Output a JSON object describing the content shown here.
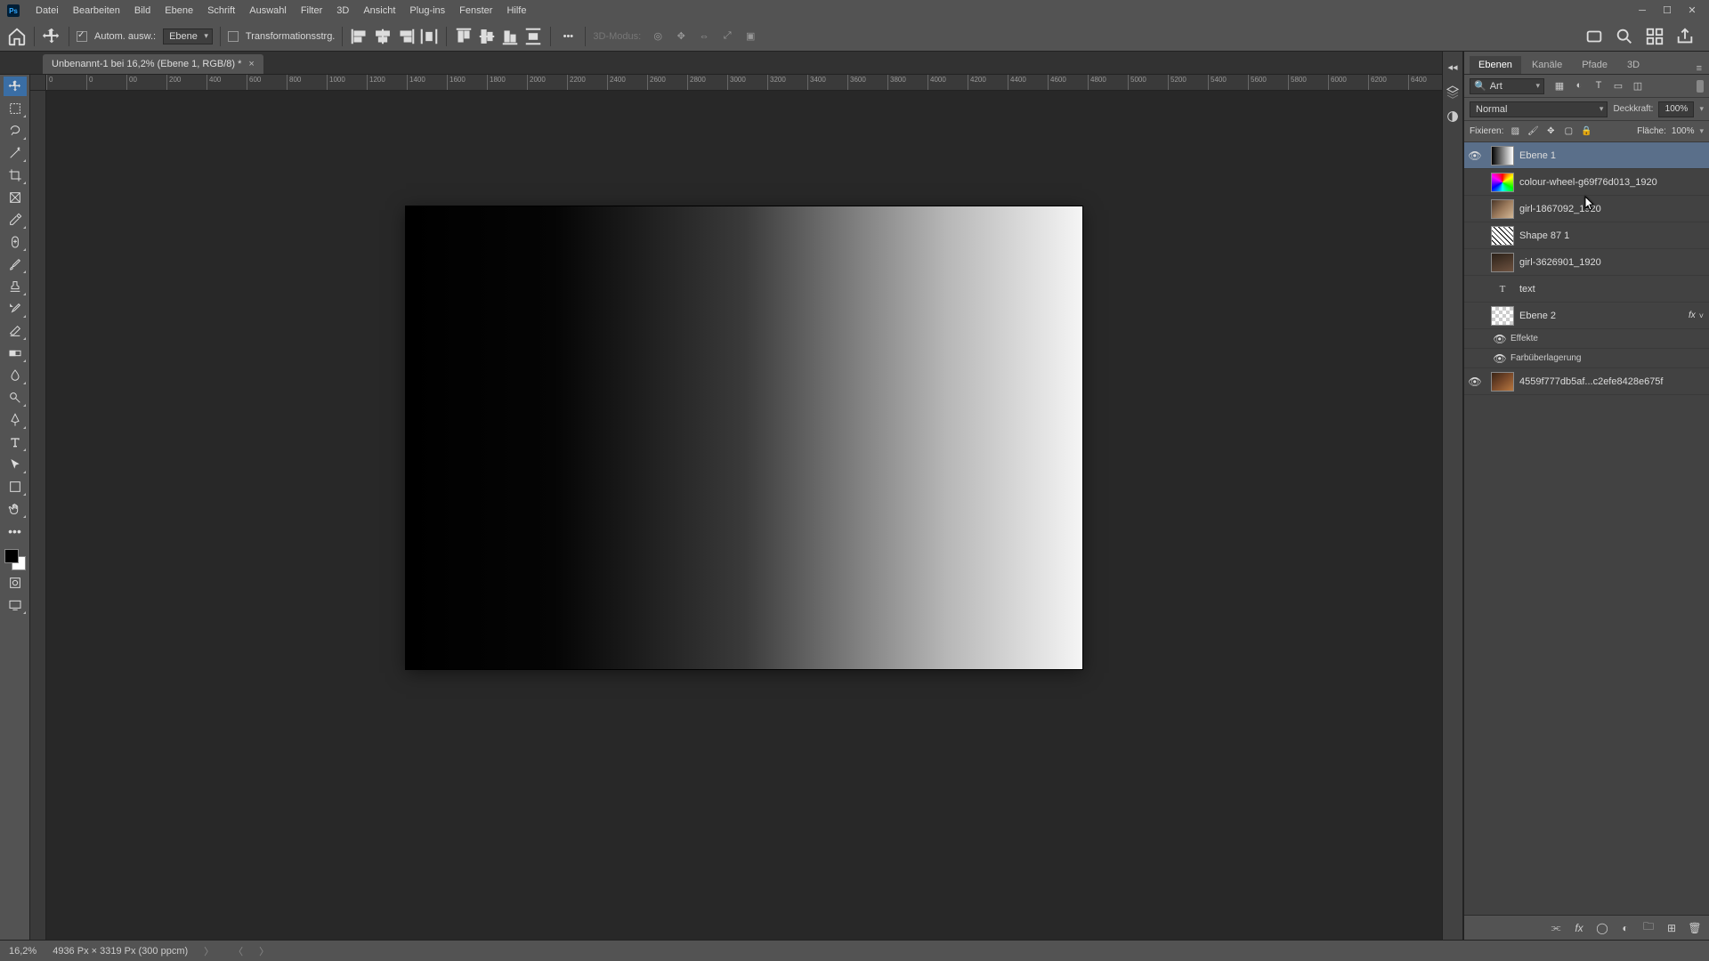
{
  "menubar": {
    "items": [
      "Datei",
      "Bearbeiten",
      "Bild",
      "Ebene",
      "Schrift",
      "Auswahl",
      "Filter",
      "3D",
      "Ansicht",
      "Plug-ins",
      "Fenster",
      "Hilfe"
    ]
  },
  "optbar": {
    "auto_select_label": "Autom. ausw.:",
    "auto_select_mode": "Ebene",
    "transform_label": "Transformationsstrg.",
    "threed_mode": "3D-Modus:"
  },
  "doc_tab": {
    "title": "Unbenannt-1 bei 16,2% (Ebene 1, RGB/8) *"
  },
  "ruler_ticks": [
    "0",
    "0",
    "00",
    "200",
    "400",
    "600",
    "800",
    "1000",
    "1200",
    "1400",
    "1600",
    "1800",
    "2000",
    "2200",
    "2400",
    "2600",
    "2800",
    "3000",
    "3200",
    "3400",
    "3600",
    "3800",
    "4000",
    "4200",
    "4400",
    "4600",
    "4800",
    "5000",
    "5200",
    "5400",
    "5600",
    "5800",
    "6000",
    "6200",
    "6400"
  ],
  "panel": {
    "tabs": [
      "Ebenen",
      "Kanäle",
      "Pfade",
      "3D"
    ],
    "search_kind": "Art",
    "blend_mode": "Normal",
    "opacity_label": "Deckkraft:",
    "opacity_value": "100%",
    "lock_label": "Fixieren:",
    "fill_label": "Fläche:",
    "fill_value": "100%",
    "fx_label": "Effekte",
    "fx_sub": "Farbüberlagerung"
  },
  "layers": [
    {
      "name": "Ebene 1",
      "visible": true,
      "selected": true,
      "thumb": "gradient"
    },
    {
      "name": "colour-wheel-g69f76d013_1920",
      "visible": false,
      "thumb": "wheel"
    },
    {
      "name": "girl-1867092_1920",
      "visible": false,
      "thumb": "photo1"
    },
    {
      "name": "Shape 87 1",
      "visible": false,
      "thumb": "shape"
    },
    {
      "name": "girl-3626901_1920",
      "visible": false,
      "thumb": "photo2"
    },
    {
      "name": "text",
      "visible": false,
      "thumb": "T"
    },
    {
      "name": "Ebene 2",
      "visible": false,
      "thumb": "checker",
      "fx": true
    },
    {
      "name": "4559f777db5af...c2efe8428e675f",
      "visible": true,
      "thumb": "photo3"
    }
  ],
  "statusbar": {
    "zoom": "16,2%",
    "info": "4936 Px × 3319 Px (300 ppcm)"
  }
}
